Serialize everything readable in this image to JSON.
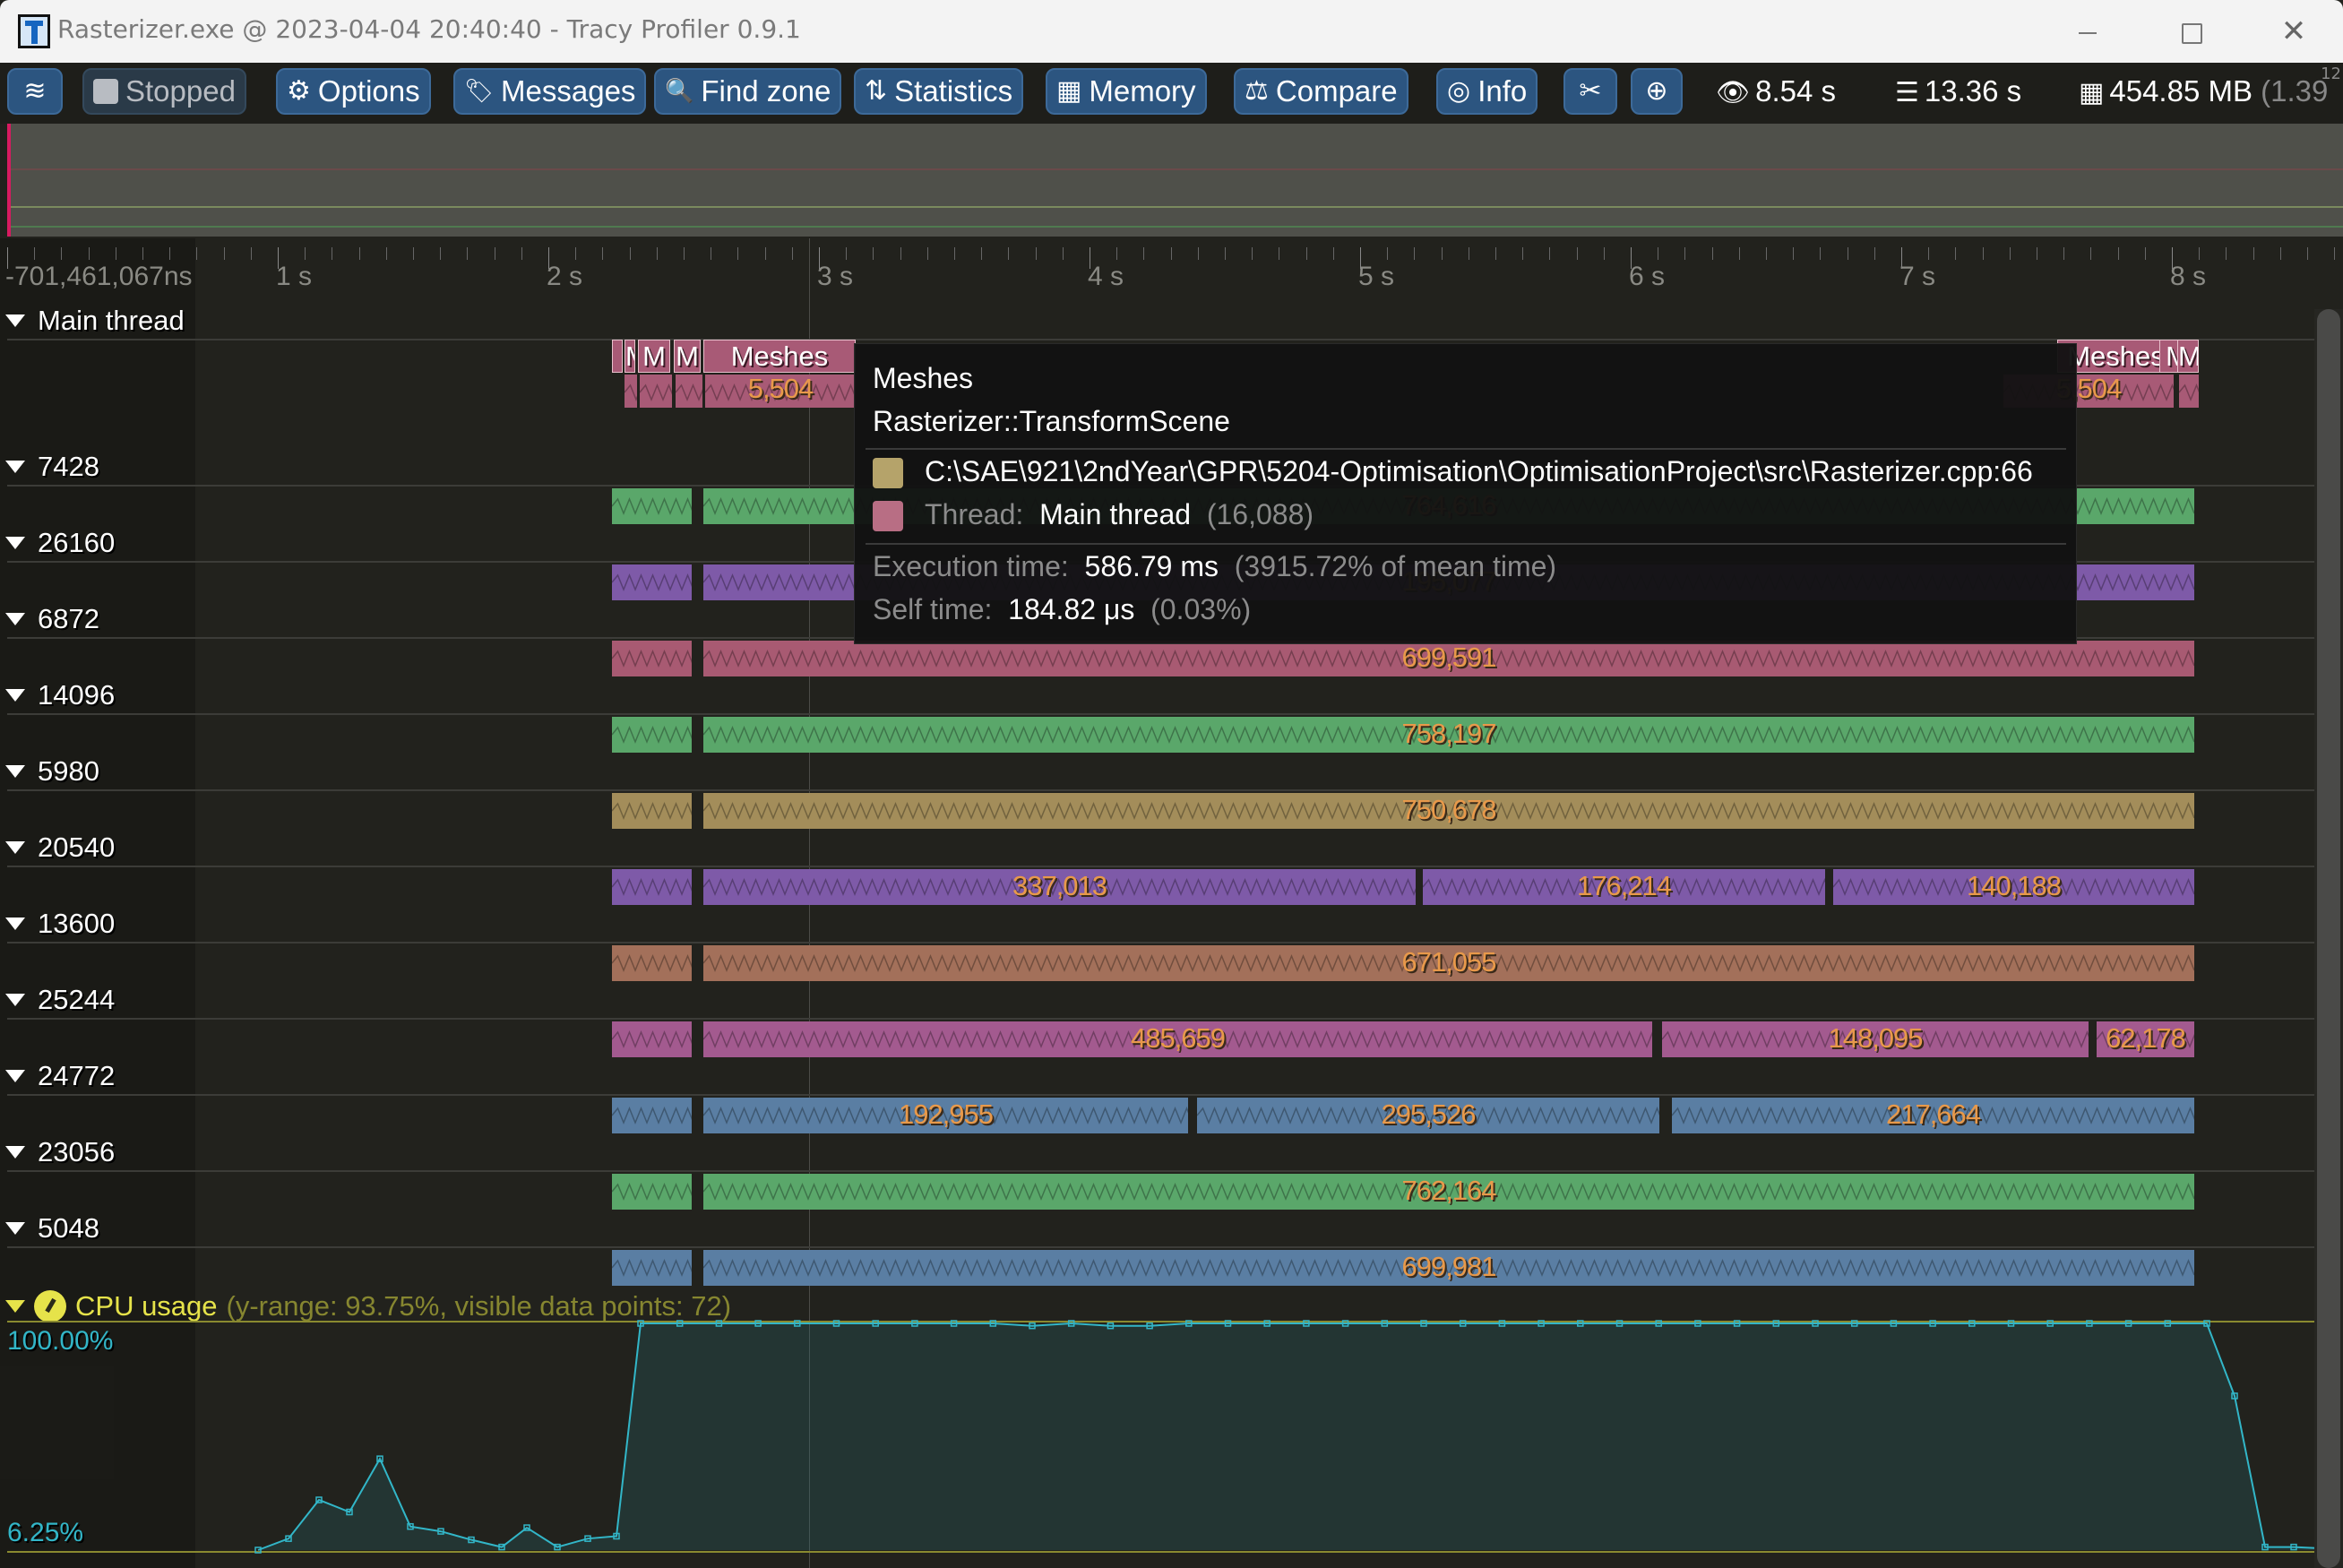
{
  "window": {
    "title": "Rasterizer.exe @ 2023-04-04 20:40:40 - Tracy Profiler 0.9.1",
    "minimize_label": "—",
    "close_label": "✕"
  },
  "toolbar": {
    "connection_icon": "wifi-icon",
    "buttons": [
      {
        "label": "Stopped",
        "icon": "stop-square-icon",
        "glyph": ""
      },
      {
        "label": "Options",
        "icon": "gear-icon",
        "glyph": "⚙"
      },
      {
        "label": "Messages",
        "icon": "tags-icon",
        "glyph": "🏷"
      },
      {
        "label": "Find zone",
        "icon": "search-icon",
        "glyph": "🔍"
      },
      {
        "label": "Statistics",
        "icon": "sort-amount-icon",
        "glyph": "⇅"
      },
      {
        "label": "Memory",
        "icon": "memory-icon",
        "glyph": "▦"
      },
      {
        "label": "Compare",
        "icon": "scale-balance-icon",
        "glyph": "⚖"
      },
      {
        "label": "Info",
        "icon": "fingerprint-icon",
        "glyph": "◎"
      }
    ],
    "tools_glyph": "✂",
    "zoom_glyph": "⊕",
    "wifi_glyph": "≋",
    "stats": {
      "view_time": "8.54 s",
      "view_icon_glyph": "👁",
      "total_time": "13.36 s",
      "db_icon_glyph": "☰",
      "memory": "454.85 MB",
      "memory_icon_glyph": "▦",
      "memory_extra": "(1.39",
      "corner_number": "12"
    }
  },
  "timeline": {
    "start_label": "-701,461,067ns",
    "ticks": [
      {
        "label": "1 s",
        "sec": 1
      },
      {
        "label": "2 s",
        "sec": 2
      },
      {
        "label": "3 s",
        "sec": 3
      },
      {
        "label": "4 s",
        "sec": 4
      },
      {
        "label": "5 s",
        "sec": 5
      },
      {
        "label": "6 s",
        "sec": 6
      },
      {
        "label": "7 s",
        "sec": 7
      },
      {
        "label": "8 s",
        "sec": 8
      }
    ]
  },
  "main_thread": {
    "label": "Main thread",
    "zone_name": "Meshes",
    "visible_zones": [
      {
        "label": "M"
      },
      {
        "label": "M"
      },
      {
        "label": "M"
      },
      {
        "label": "Meshes",
        "value": "5,504"
      },
      {
        "label": "Meshes",
        "value": "5,504"
      },
      {
        "label": "M"
      },
      {
        "label": "M"
      }
    ],
    "right_zone_label": "Meshes",
    "right_zone_value": "5,504"
  },
  "threads": [
    {
      "id": "7428",
      "color": "#5aa76a",
      "zones": [
        {
          "value": ""
        },
        {
          "value": "764,616"
        }
      ]
    },
    {
      "id": "26160",
      "color": "#7e5aa8",
      "zones": [
        {
          "value": ""
        },
        {
          "value": "195,077"
        }
      ]
    },
    {
      "id": "6872",
      "color": "#a85a72",
      "zones": [
        {
          "value": ""
        },
        {
          "value": "699,591"
        }
      ]
    },
    {
      "id": "14096",
      "color": "#5aa76a",
      "zones": [
        {
          "value": ""
        },
        {
          "value": "758,197"
        }
      ]
    },
    {
      "id": "5980",
      "color": "#a38d5a",
      "zones": [
        {
          "value": ""
        },
        {
          "value": "750,678"
        }
      ]
    },
    {
      "id": "20540",
      "color": "#7e5aa8",
      "zones": [
        {
          "value": ""
        },
        {
          "value": "337,013"
        },
        {
          "value": "176,214"
        },
        {
          "value": "140,188"
        }
      ]
    },
    {
      "id": "13600",
      "color": "#a3705a",
      "zones": [
        {
          "value": ""
        },
        {
          "value": "671,055"
        }
      ]
    },
    {
      "id": "25244",
      "color": "#a35a8f",
      "zones": [
        {
          "value": ""
        },
        {
          "value": "485,659"
        },
        {
          "value": "148,095"
        },
        {
          "value": "62,178"
        }
      ]
    },
    {
      "id": "24772",
      "color": "#5a7ea3",
      "zones": [
        {
          "value": ""
        },
        {
          "value": "192,955"
        },
        {
          "value": "295,526"
        },
        {
          "value": "217,664"
        }
      ]
    },
    {
      "id": "23056",
      "color": "#5aa76a",
      "zones": [
        {
          "value": ""
        },
        {
          "value": "762,164"
        }
      ]
    },
    {
      "id": "5048",
      "color": "#5a7ea3",
      "zones": [
        {
          "value": ""
        },
        {
          "value": "699,981"
        }
      ]
    }
  ],
  "tooltip": {
    "zone_name": "Meshes",
    "function": "Rasterizer::TransformScene",
    "source_location": "C:\\SAE\\921\\2ndYear\\GPR\\5204-Optimisation\\OptimisationProject\\src\\Rasterizer.cpp:66",
    "source_color": "#b5a36a",
    "thread_label": "Thread:",
    "thread_name": "Main thread",
    "thread_id": "(16,088)",
    "thread_color": "#b86e84",
    "exec_label": "Execution time:",
    "exec_value": "586.79 ms",
    "exec_extra": "(3915.72% of mean time)",
    "self_label": "Self time:",
    "self_value": "184.82 μs",
    "self_extra": "(0.03%)"
  },
  "cpu": {
    "label": "CPU usage",
    "subtitle": "(y-range: 93.75%, visible data points: 72)",
    "max_label": "100.00%",
    "min_label": "6.25%",
    "line_color": "#32b6c8",
    "points_pct": [
      6.25,
      11,
      27,
      22,
      44,
      16,
      14,
      10.5,
      7.5,
      15.5,
      7.5,
      11,
      12,
      100,
      100,
      100,
      100,
      100,
      100,
      100,
      100,
      100,
      100,
      99,
      100,
      99,
      99,
      100,
      100,
      100,
      100,
      100,
      100,
      100,
      100,
      100,
      100,
      100,
      100,
      100,
      100,
      100,
      100,
      100,
      100,
      100,
      100,
      100,
      100,
      100,
      100,
      100,
      100,
      100,
      70,
      7.5,
      7.5,
      7
    ]
  }
}
